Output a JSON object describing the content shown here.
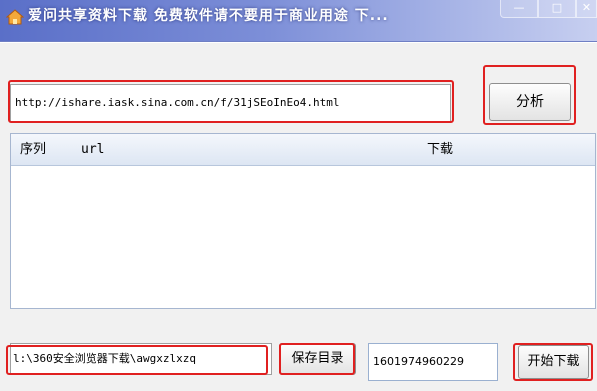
{
  "window": {
    "title": "爱问共享资料下载 免费软件请不要用于商业用途 下...",
    "minimize_glyph": "—",
    "maximize_glyph": "□",
    "close_glyph": "✕",
    "icon": "app-house-icon"
  },
  "url_input": {
    "value": "http://ishare.iask.sina.com.cn/f/31jSEoInEo4.html"
  },
  "analyze_button": {
    "label": "分析"
  },
  "list": {
    "columns": [
      {
        "label": "序列"
      },
      {
        "label": "url"
      },
      {
        "label": "下载"
      }
    ],
    "rows": []
  },
  "save_path": {
    "value": "l:\\360安全浏览器下载\\awgxzlxzq"
  },
  "save_dir_button": {
    "label": "保存目录"
  },
  "code_field": {
    "value": "1601974960229"
  },
  "start_download_button": {
    "label": "开始下载"
  },
  "colors": {
    "highlight": "#e02020",
    "titlebar_start": "#5a6fc8",
    "titlebar_end": "#c7cff0",
    "list_header": "#dde6f3"
  }
}
